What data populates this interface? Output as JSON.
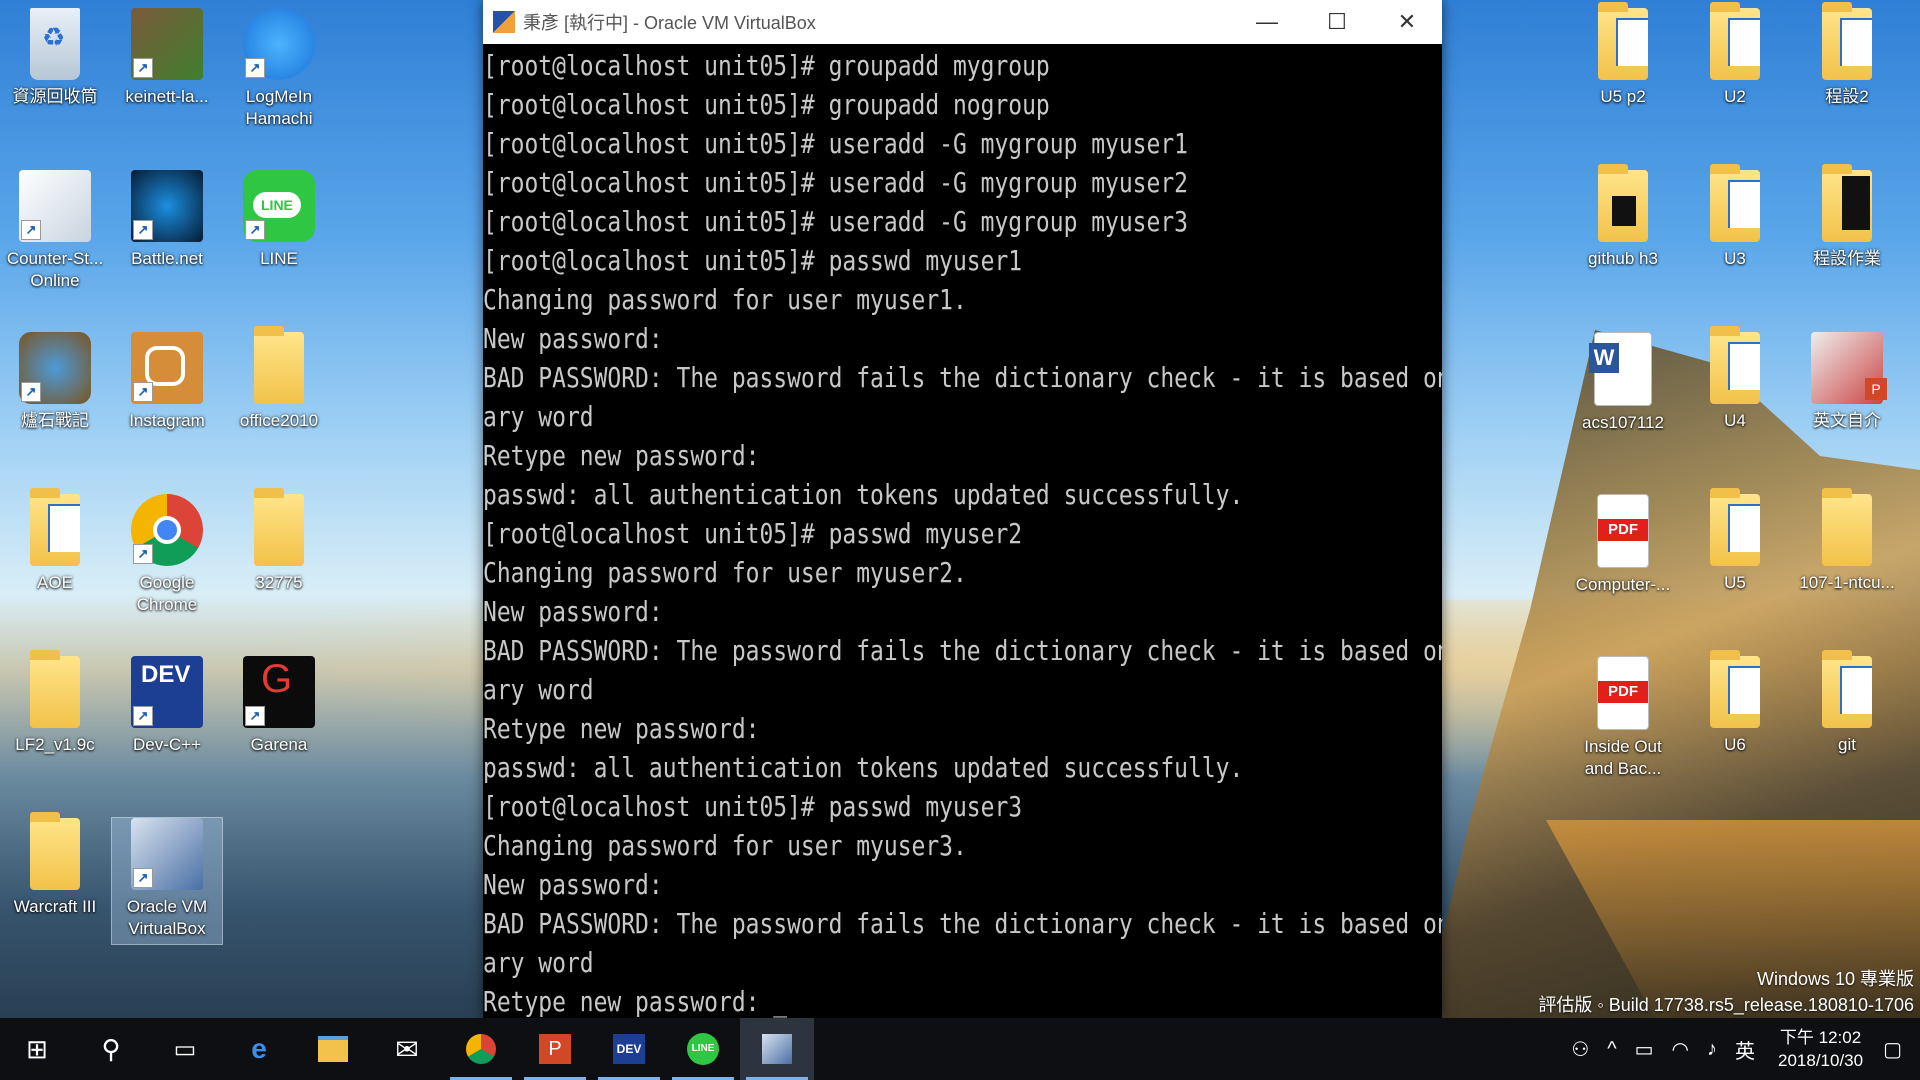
{
  "desktop": {
    "left_icons": [
      {
        "label": "資源回收筒",
        "icon": "recycle-bin-icon"
      },
      {
        "label": "keinett-la...",
        "icon": "minecraft-icon"
      },
      {
        "label": "LogMeIn Hamachi",
        "icon": "hamachi-icon"
      },
      {
        "label": "Counter-St... Online",
        "icon": "counter-strike-icon"
      },
      {
        "label": "Battle.net",
        "icon": "battlenet-icon"
      },
      {
        "label": "LINE",
        "icon": "line-icon"
      },
      {
        "label": "爐石戰記",
        "icon": "hearthstone-icon"
      },
      {
        "label": "Instagram",
        "icon": "instagram-icon"
      },
      {
        "label": "office2010",
        "icon": "folder-icon"
      },
      {
        "label": "AOE",
        "icon": "folder-icon"
      },
      {
        "label": "Google Chrome",
        "icon": "chrome-icon"
      },
      {
        "label": "32775",
        "icon": "folder-icon"
      },
      {
        "label": "LF2_v1.9c",
        "icon": "folder-icon"
      },
      {
        "label": "Dev-C++",
        "icon": "devcpp-icon"
      },
      {
        "label": "Garena",
        "icon": "garena-icon"
      },
      {
        "label": "Warcraft III",
        "icon": "folder-icon"
      },
      {
        "label": "Oracle VM VirtualBox",
        "icon": "virtualbox-icon"
      }
    ],
    "right_icons": [
      {
        "label": "U5 p2",
        "icon": "folder-icon"
      },
      {
        "label": "U2",
        "icon": "folder-icon"
      },
      {
        "label": "程設2",
        "icon": "folder-icon"
      },
      {
        "label": "github h3",
        "icon": "folder-icon"
      },
      {
        "label": "U3",
        "icon": "folder-icon"
      },
      {
        "label": "程設作業",
        "icon": "folder-icon"
      },
      {
        "label": "acs107112",
        "icon": "word-doc-icon"
      },
      {
        "label": "U4",
        "icon": "folder-icon"
      },
      {
        "label": "英文自介",
        "icon": "powerpoint-icon"
      },
      {
        "label": "Computer-...",
        "icon": "pdf-icon"
      },
      {
        "label": "U5",
        "icon": "folder-icon"
      },
      {
        "label": "107-1-ntcu...",
        "icon": "folder-icon"
      },
      {
        "label": "Inside Out and Bac...",
        "icon": "pdf-icon"
      },
      {
        "label": "U6",
        "icon": "folder-icon"
      },
      {
        "label": "git",
        "icon": "folder-icon"
      }
    ]
  },
  "window": {
    "title": "秉彥 [執行中] - Oracle VM VirtualBox",
    "minimize": "—",
    "maximize": "☐",
    "close": "✕"
  },
  "terminal": {
    "lines": [
      "[root@localhost unit05]# groupadd mygroup",
      "[root@localhost unit05]# groupadd nogroup",
      "[root@localhost unit05]# useradd -G mygroup myuser1",
      "[root@localhost unit05]# useradd -G mygroup myuser2",
      "[root@localhost unit05]# useradd -G mygroup myuser3",
      "[root@localhost unit05]# passwd myuser1",
      "Changing password for user myuser1.",
      "New password:",
      "BAD PASSWORD: The password fails the dictionary check - it is based on a diction",
      "ary word",
      "Retype new password:",
      "passwd: all authentication tokens updated successfully.",
      "[root@localhost unit05]# passwd myuser2",
      "Changing password for user myuser2.",
      "New password:",
      "BAD PASSWORD: The password fails the dictionary check - it is based on a diction",
      "ary word",
      "Retype new password:",
      "passwd: all authentication tokens updated successfully.",
      "[root@localhost unit05]# passwd myuser3",
      "Changing password for user myuser3.",
      "New password:",
      "BAD PASSWORD: The password fails the dictionary check - it is based on a diction",
      "ary word",
      "Retype new password: _"
    ]
  },
  "watermark": {
    "line1": "Windows 10 專業版",
    "line2": "評估版 ◦ Build 17738.rs5_release.180810-1706"
  },
  "taskbar": {
    "apps": [
      {
        "icon": "edge-icon"
      },
      {
        "icon": "file-explorer-icon"
      },
      {
        "icon": "mail-icon"
      },
      {
        "icon": "chrome-icon"
      },
      {
        "icon": "powerpoint-icon"
      },
      {
        "icon": "devcpp-icon"
      },
      {
        "icon": "line-icon"
      },
      {
        "icon": "virtualbox-icon"
      }
    ],
    "ime": "英",
    "time": "下午 12:02",
    "date": "2018/10/30"
  }
}
